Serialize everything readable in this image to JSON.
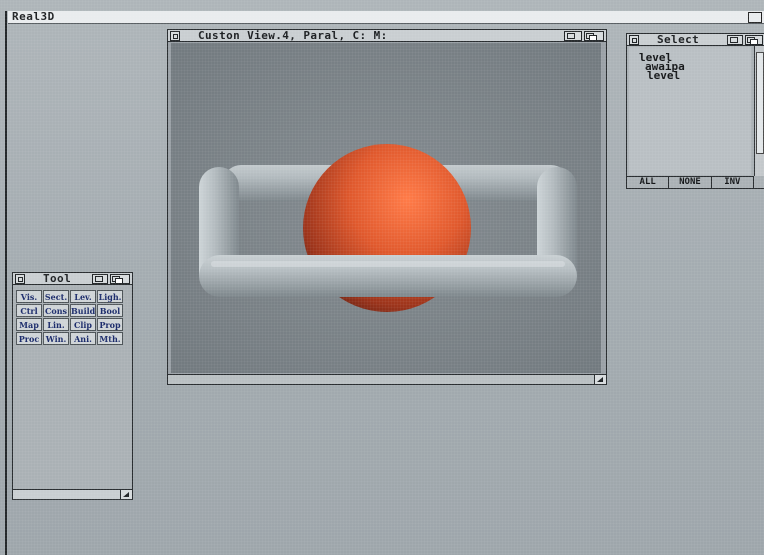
{
  "screen": {
    "title": "Real3D"
  },
  "view_window": {
    "title": "Custon View.4, Paral, C: M:"
  },
  "select_window": {
    "title": "Select",
    "items": [
      "level",
      "awaipa",
      "level"
    ],
    "buttons": [
      "ALL",
      "NONE",
      "INV"
    ]
  },
  "tool_window": {
    "title": "Tool",
    "buttons": [
      "Vis.",
      "Sect.",
      "Lev.",
      "Ligh.",
      "Ctrl",
      "Cons",
      "Build",
      "Bool",
      "Map",
      "Lin.",
      "Clip",
      "Prop",
      "Proc",
      "Win.",
      "Ani.",
      "Mth."
    ]
  },
  "scene": {
    "sphere_color": "#e0592d",
    "frame_color": "#a9b2b6",
    "bg_color": "#7c8388"
  }
}
